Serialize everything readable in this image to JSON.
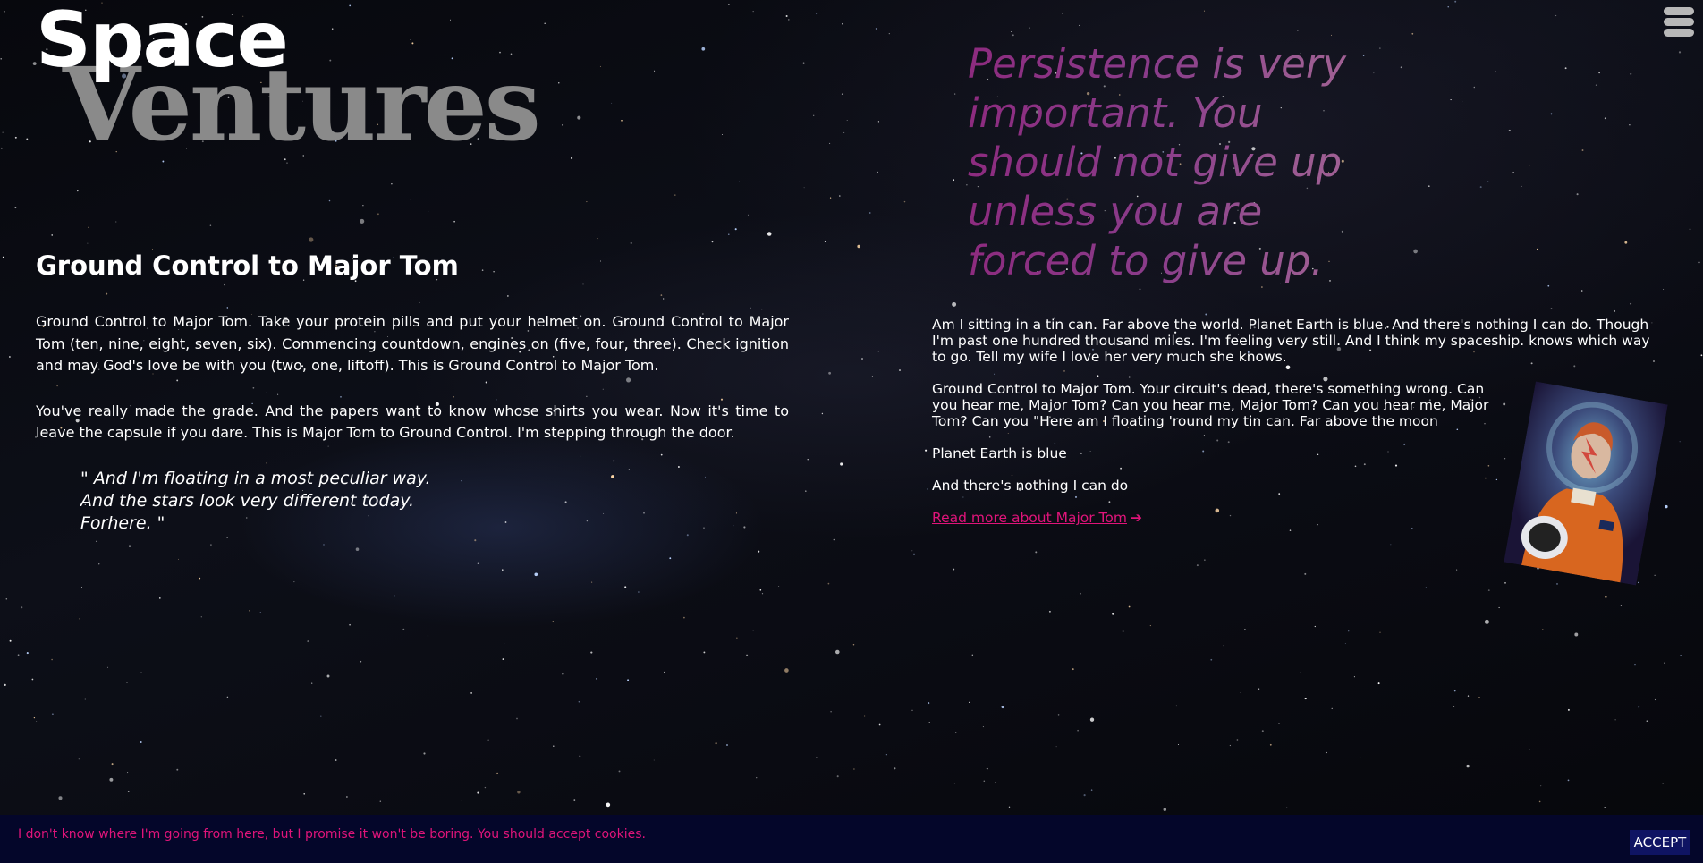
{
  "logo": {
    "line1": "Space",
    "line2": "Ventures"
  },
  "menu": {
    "icon": "hamburger-menu-icon"
  },
  "article": {
    "title": "Ground Control to Major Tom",
    "paragraphs": [
      "Ground Control to Major Tom. Take your protein pills and put your helmet on. Ground Control to Major Tom (ten, nine, eight, seven, six). Commencing countdown, engines on (five, four, three). Check ignition and may God's love be with you (two, one, liftoff). This is Ground Control to Major Tom.",
      "You've really made the grade. And the papers want to know whose shirts you wear. Now it's time to leave the capsule if you dare. This is Major Tom to Ground Control. I'm stepping through the door."
    ],
    "quote_lines": [
      "\" And I'm floating in a most peculiar way.",
      "And the stars look very different today.",
      "Forhere. \""
    ]
  },
  "big_quote": "Persistence is very important. You should not give up unless you are forced to give up.",
  "aside": {
    "paragraphs": [
      "Am I sitting in a tin can. Far above the world. Planet Earth is blue. And there's nothing I can do. Though I'm past one hundred thousand miles. I'm feeling very still. And I think my spaceship. knows which way to go. Tell my wife I love her very much she knows.",
      "Ground Control to Major Tom. Your circuit's dead, there's something wrong. Can you hear me, Major Tom? Can you hear me, Major Tom? Can you hear me, Major Tom? Can you \"Here am I floating 'round my tin can. Far above the moon",
      "Planet Earth is blue",
      "And there's nothing I can do"
    ],
    "read_more_label": "Read more about Major Tom",
    "read_more_icon": "arrow-right-icon",
    "image": "astronaut-portrait"
  },
  "cookie": {
    "text": "I don't know where I'm going from here, but I promise it won't be boring. You should accept cookies.",
    "accept_label": "ACCEPT"
  },
  "colors": {
    "accent": "#e0147a",
    "quote_gradient_start": "#8d2b7f",
    "cookie_bar": "#04062a",
    "accept_button": "#0f1463"
  }
}
